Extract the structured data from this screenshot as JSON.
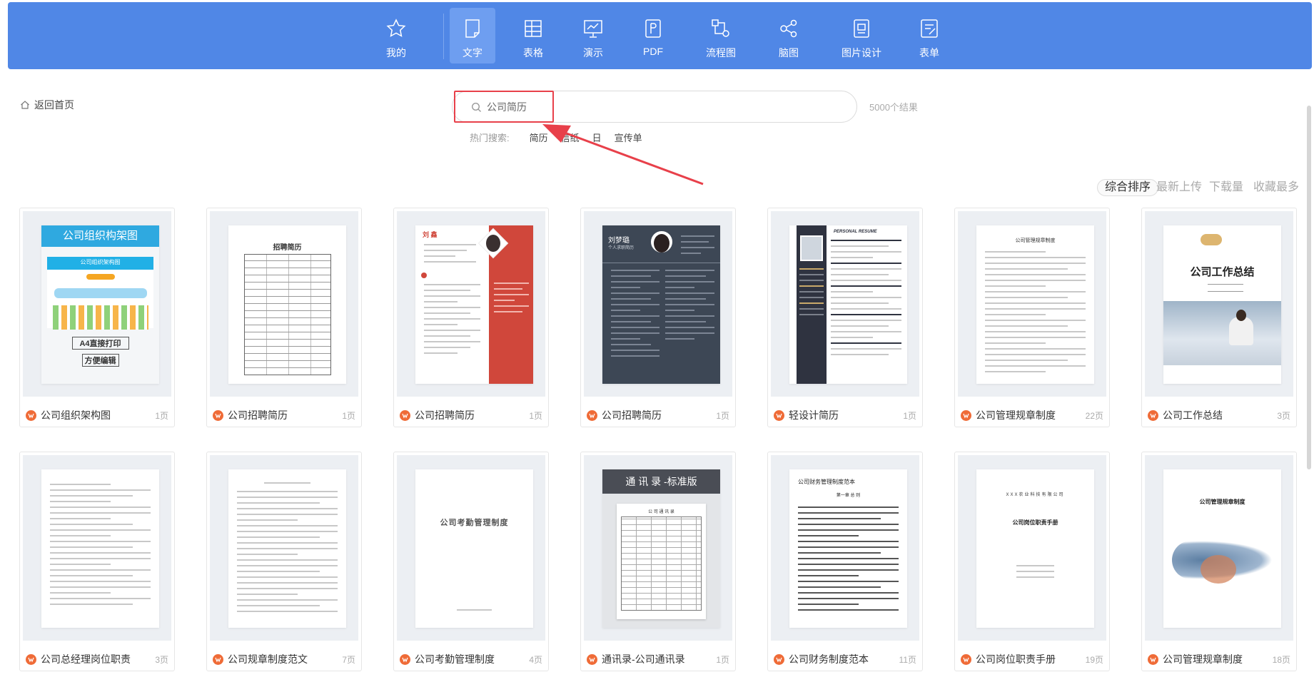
{
  "categories": [
    {
      "label": "我的",
      "icon": "star-icon"
    },
    {
      "label": "文字",
      "icon": "document-icon",
      "active": true
    },
    {
      "label": "表格",
      "icon": "table-icon"
    },
    {
      "label": "演示",
      "icon": "presentation-icon"
    },
    {
      "label": "PDF",
      "icon": "pdf-icon"
    },
    {
      "label": "流程图",
      "icon": "flowchart-icon"
    },
    {
      "label": "脑图",
      "icon": "mindmap-icon"
    },
    {
      "label": "图片设计",
      "icon": "image-design-icon"
    },
    {
      "label": "表单",
      "icon": "form-icon"
    }
  ],
  "nav": {
    "back_label": "返回首页"
  },
  "search": {
    "value": "公司简历",
    "result_count": "5000个结果"
  },
  "hot_search": {
    "label": "热门搜索:",
    "items": [
      "简历",
      "信纸",
      "日",
      "宣传单"
    ]
  },
  "sort": {
    "options": [
      "综合排序",
      "最新上传",
      "下载量",
      "收藏最多"
    ],
    "active": "综合排序"
  },
  "thumb_text": {
    "org_title": "公司组织构架图",
    "org_inner": "公司组织架构图",
    "org_a4": "A4直接打印",
    "org_edit": "方便编辑",
    "recruit_title": "招聘简历",
    "resume_name": "刘 鑫",
    "resume_dark_name": "刘梦璐",
    "resume_dark_sub": "个人求职简历",
    "personal_resume": "PERSONAL RESUME",
    "rules_title": "公司管理规章制度",
    "work_summary": "公司工作总结",
    "attendance_title": "公司考勤管理制度",
    "directory_title": "通 讯 录 -标准版",
    "directory_inner": "公 司 通 讯 录",
    "finance_title": "公司财务管理制度范本",
    "finance_chapter": "第一章 总 则",
    "company_header": "XXX农业科技有限公司",
    "position_manual": "公司岗位职责手册",
    "rules_title2": "公司管理规章制度"
  },
  "cards": [
    {
      "title": "公司组织架构图",
      "pages": "1页"
    },
    {
      "title": "公司招聘简历",
      "pages": "1页"
    },
    {
      "title": "公司招聘简历",
      "pages": "1页"
    },
    {
      "title": "公司招聘简历",
      "pages": "1页"
    },
    {
      "title": "轻设计简历",
      "pages": "1页"
    },
    {
      "title": "公司管理规章制度",
      "pages": "22页"
    },
    {
      "title": "公司工作总结",
      "pages": "3页"
    },
    {
      "title": "公司总经理岗位职责",
      "pages": "3页"
    },
    {
      "title": "公司规章制度范文",
      "pages": "7页"
    },
    {
      "title": "公司考勤管理制度",
      "pages": "4页"
    },
    {
      "title": "通讯录-公司通讯录",
      "pages": "1页"
    },
    {
      "title": "公司财务制度范本",
      "pages": "11页"
    },
    {
      "title": "公司岗位职责手册",
      "pages": "19页"
    },
    {
      "title": "公司管理规章制度",
      "pages": "18页"
    }
  ],
  "colors": {
    "topbar": "#5087e6",
    "active_tab": "#6e9ef0",
    "highlight": "#e8404a",
    "wps_icon": "#ef6b37"
  }
}
